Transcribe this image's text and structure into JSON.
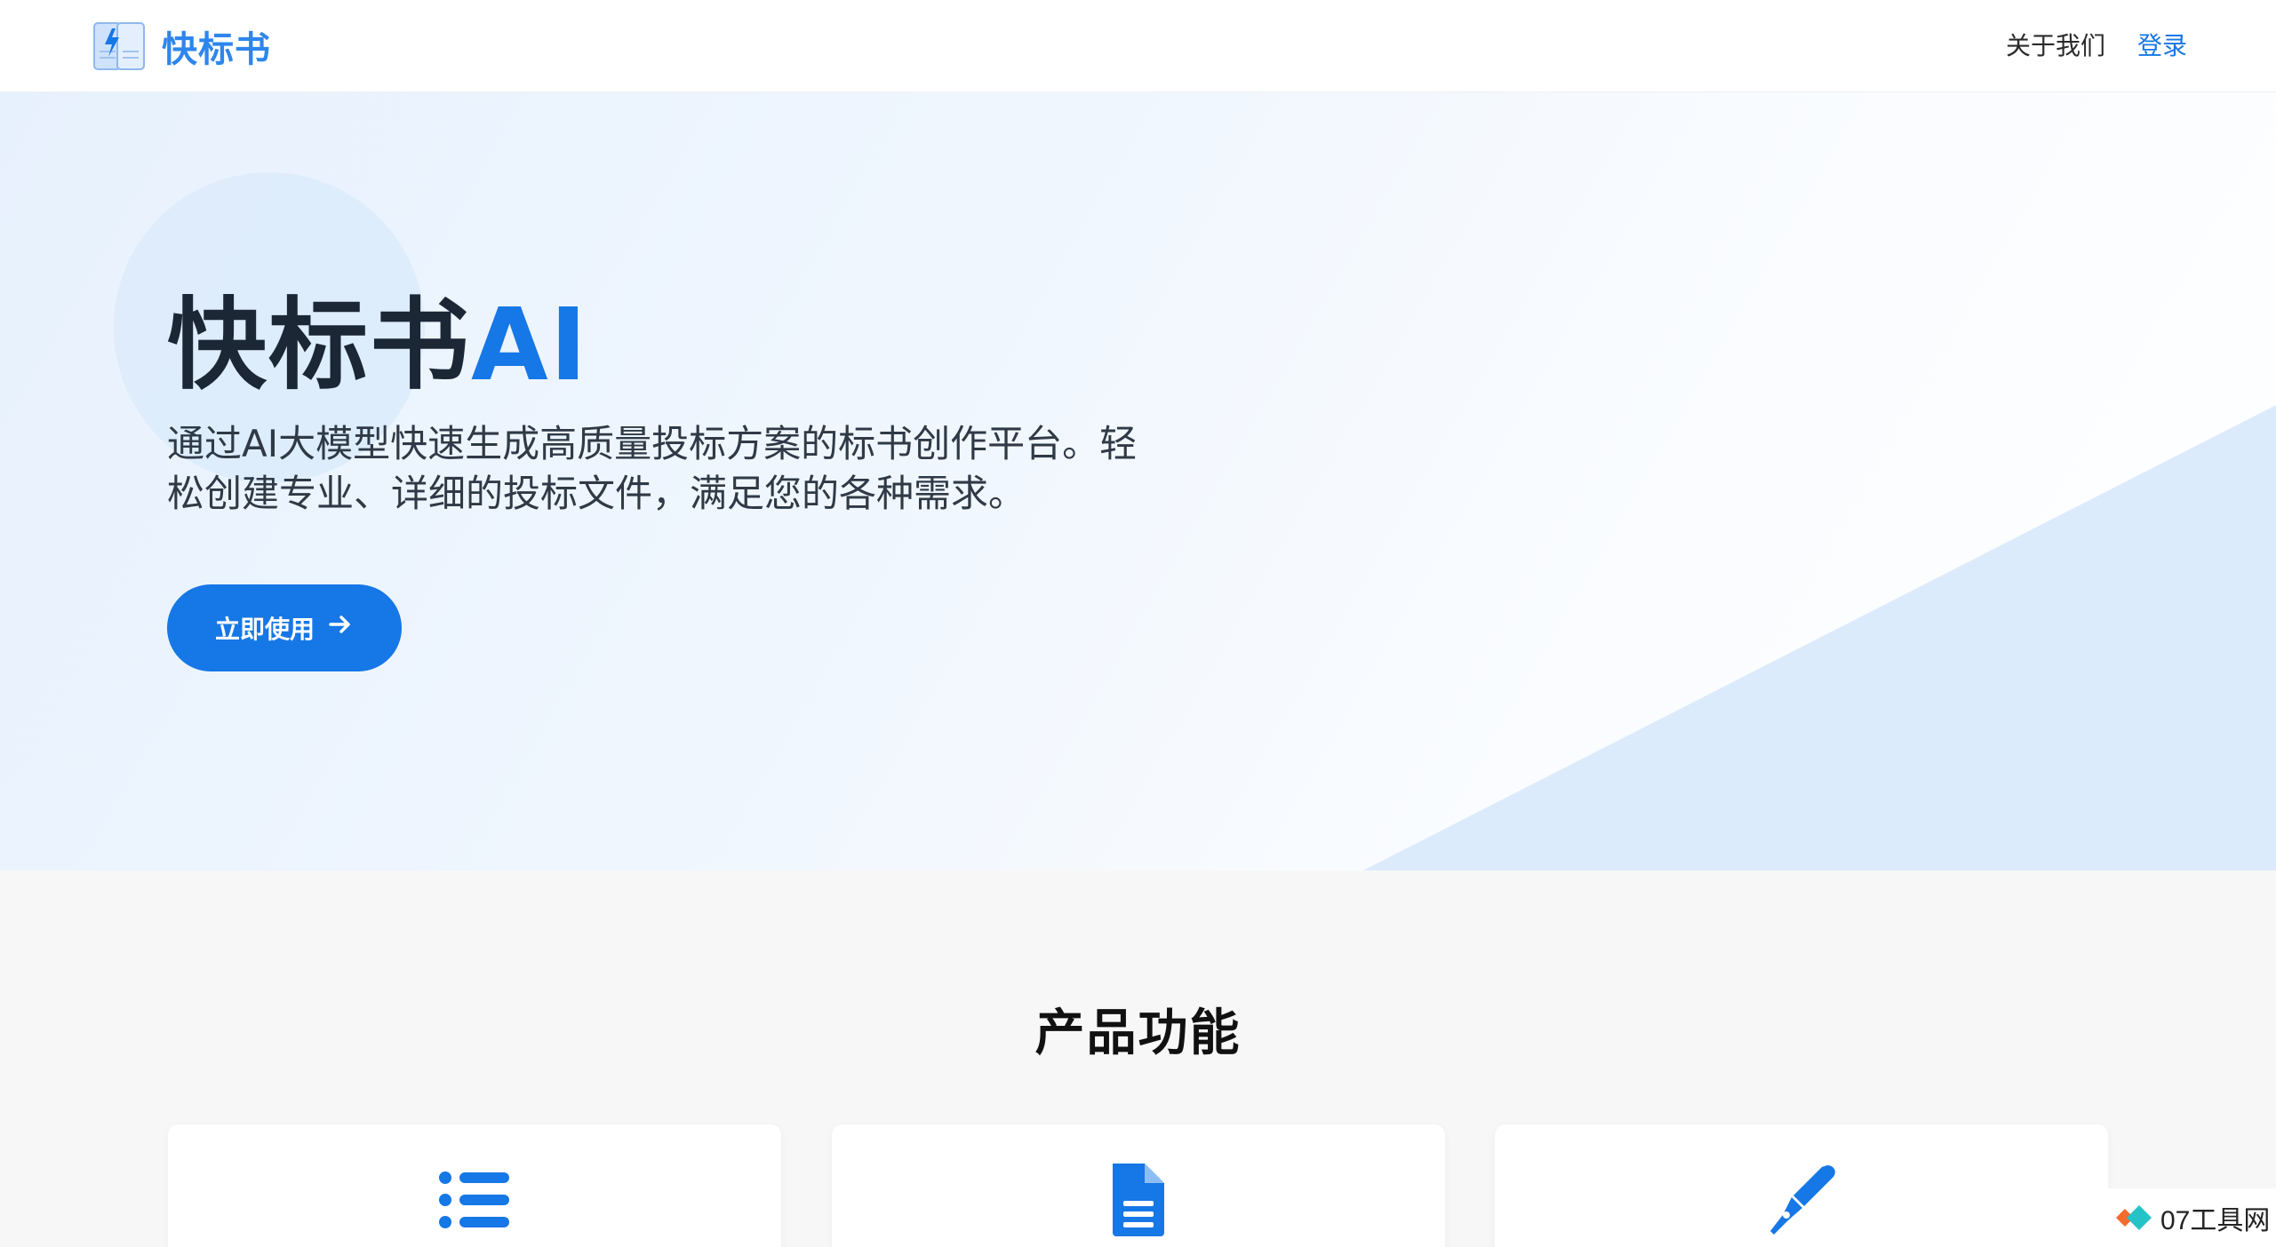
{
  "header": {
    "logo_text": "快标书",
    "nav": {
      "about_label": "关于我们",
      "login_label": "登录"
    }
  },
  "hero": {
    "title_main": "快标书",
    "title_accent": "AI",
    "description": "通过AI大模型快速生成高质量投标方案的标书创作平台。轻松创建专业、详细的投标文件，满足您的各种需求。",
    "cta_label": "立即使用",
    "cta_icon": "arrow-right-icon"
  },
  "features": {
    "section_title": "产品功能",
    "cards": [
      {
        "icon": "list-icon"
      },
      {
        "icon": "document-icon"
      },
      {
        "icon": "pen-icon"
      }
    ]
  },
  "watermark": {
    "text": "07工具网"
  },
  "colors": {
    "accent": "#1677e6",
    "logo_text": "#2e86ec",
    "title_dark": "#1b2735",
    "hero_bg": "#e7f1fd",
    "section_bg": "#f7f7f7"
  }
}
